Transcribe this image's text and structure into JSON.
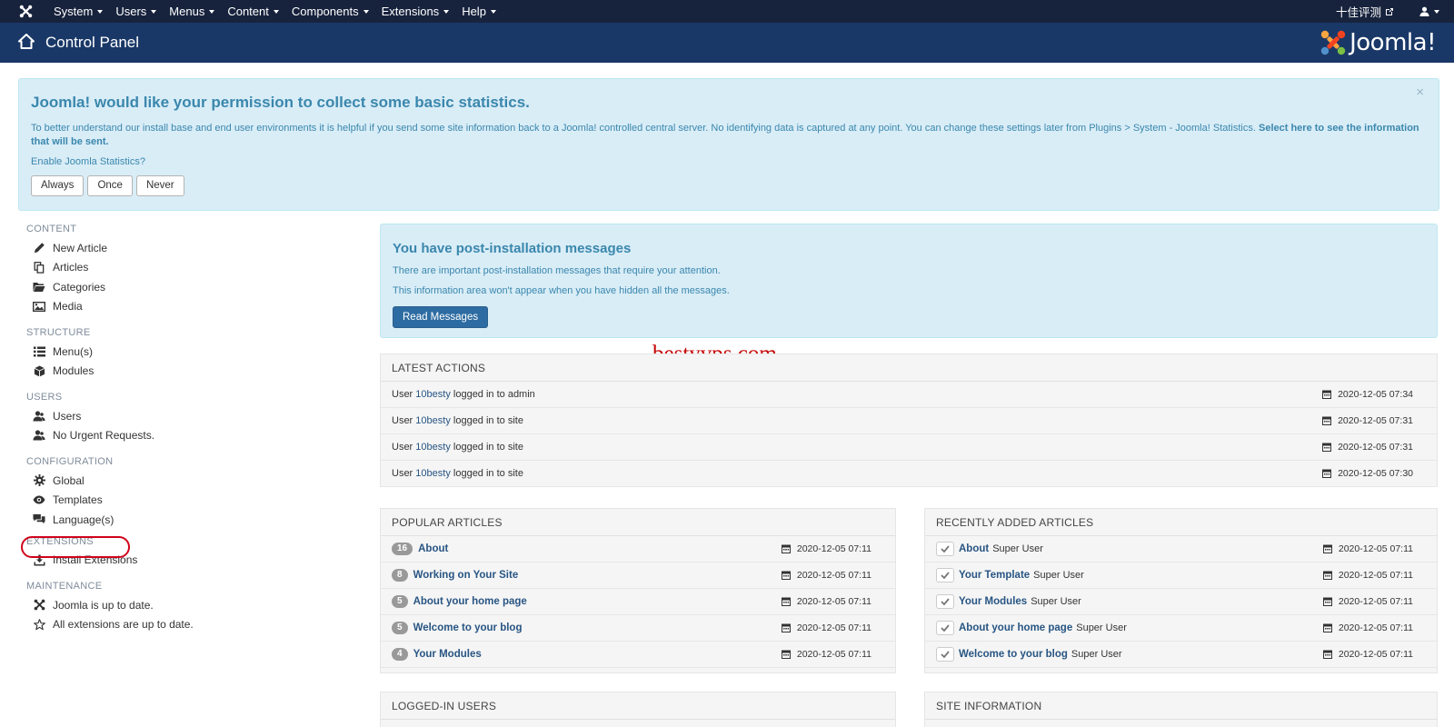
{
  "nav": {
    "menu": [
      {
        "label": "System"
      },
      {
        "label": "Users"
      },
      {
        "label": "Menus"
      },
      {
        "label": "Content"
      },
      {
        "label": "Components"
      },
      {
        "label": "Extensions"
      },
      {
        "label": "Help"
      }
    ],
    "site_name": "十佳评测"
  },
  "header": {
    "title": "Control Panel",
    "logo_text": "Joomla!"
  },
  "stats": {
    "title": "Joomla! would like your permission to collect some basic statistics.",
    "text": "To better understand our install base and end user environments it is helpful if you send some site information back to a Joomla! controlled central server. No identifying data is captured at any point. You can change these settings later from Plugins > System - Joomla! Statistics.",
    "link": "Select here to see the information that will be sent.",
    "question": "Enable Joomla Statistics?",
    "buttons": [
      "Always",
      "Once",
      "Never"
    ],
    "close": "×"
  },
  "sidebar": {
    "sections": [
      {
        "title": "CONTENT",
        "items": [
          "New Article",
          "Articles",
          "Categories",
          "Media"
        ]
      },
      {
        "title": "STRUCTURE",
        "items": [
          "Menu(s)",
          "Modules"
        ]
      },
      {
        "title": "USERS",
        "items": [
          "Users",
          "No Urgent Requests."
        ]
      },
      {
        "title": "CONFIGURATION",
        "items": [
          "Global",
          "Templates",
          "Language(s)"
        ]
      },
      {
        "title": "EXTENSIONS",
        "items": [
          "Install Extensions"
        ]
      },
      {
        "title": "MAINTENANCE",
        "items": [
          "Joomla is up to date.",
          "All extensions are up to date."
        ]
      }
    ]
  },
  "post_install": {
    "title": "You have post-installation messages",
    "line1": "There are important post-installation messages that require your attention.",
    "line2": "This information area won't appear when you have hidden all the messages.",
    "button": "Read Messages"
  },
  "watermark": "bestyvps.com",
  "latest_actions": {
    "title": "LATEST ACTIONS",
    "rows": [
      {
        "prefix": "User",
        "user": "10besty",
        "action": "logged in to admin",
        "date": "2020-12-05 07:34"
      },
      {
        "prefix": "User",
        "user": "10besty",
        "action": "logged in to site",
        "date": "2020-12-05 07:31"
      },
      {
        "prefix": "User",
        "user": "10besty",
        "action": "logged in to site",
        "date": "2020-12-05 07:31"
      },
      {
        "prefix": "User",
        "user": "10besty",
        "action": "logged in to site",
        "date": "2020-12-05 07:30"
      }
    ]
  },
  "popular_articles": {
    "title": "POPULAR ARTICLES",
    "rows": [
      {
        "hits": "16",
        "title": "About",
        "date": "2020-12-05 07:11"
      },
      {
        "hits": "8",
        "title": "Working on Your Site",
        "date": "2020-12-05 07:11"
      },
      {
        "hits": "5",
        "title": "About your home page",
        "date": "2020-12-05 07:11"
      },
      {
        "hits": "5",
        "title": "Welcome to your blog",
        "date": "2020-12-05 07:11"
      },
      {
        "hits": "4",
        "title": "Your Modules",
        "date": "2020-12-05 07:11"
      }
    ]
  },
  "recent_articles": {
    "title": "RECENTLY ADDED ARTICLES",
    "rows": [
      {
        "title": "About",
        "author": "Super User",
        "date": "2020-12-05 07:11"
      },
      {
        "title": "Your Template",
        "author": "Super User",
        "date": "2020-12-05 07:11"
      },
      {
        "title": "Your Modules",
        "author": "Super User",
        "date": "2020-12-05 07:11"
      },
      {
        "title": "About your home page",
        "author": "Super User",
        "date": "2020-12-05 07:11"
      },
      {
        "title": "Welcome to your blog",
        "author": "Super User",
        "date": "2020-12-05 07:11"
      }
    ]
  },
  "logged_in_users": {
    "title": "LOGGED-IN USERS"
  },
  "site_information": {
    "title": "SITE INFORMATION"
  },
  "colors": {
    "navbar": "#17233d",
    "header": "#1a3867",
    "alert_bg": "#d9edf7",
    "alert_text": "#3a87ad",
    "primary_button": "#2d6ca2",
    "link": "#285583",
    "highlight_circle": "#d0021b"
  }
}
